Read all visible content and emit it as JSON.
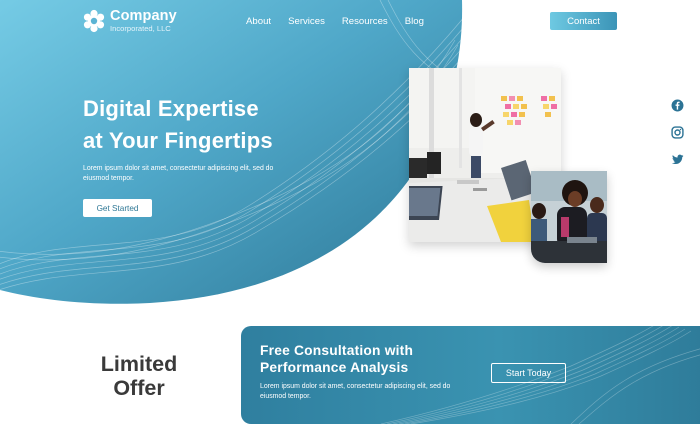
{
  "colors": {
    "accent": "#3b94b7",
    "hero_light": "#6cc4e0",
    "hero_dark": "#2f7898",
    "offer_text": "#3a3a3a"
  },
  "brand": {
    "name": "Company",
    "subtitle": "Incorporated, LLC",
    "logo_icon": "flower-gear-logo"
  },
  "nav": {
    "items": [
      {
        "label": "About"
      },
      {
        "label": "Services"
      },
      {
        "label": "Resources"
      },
      {
        "label": "Blog"
      }
    ],
    "contact_label": "Contact"
  },
  "hero": {
    "title_line1": "Digital Expertise",
    "title_line2": "at Your Fingertips",
    "description": "Lorem ipsum dolor sit amet, consectetur adipiscing elit, sed do eiusmod tempor.",
    "cta_label": "Get Started"
  },
  "social": {
    "icons": [
      "facebook-icon",
      "instagram-icon",
      "twitter-icon"
    ]
  },
  "offer": {
    "heading_line1": "Limited",
    "heading_line2": "Offer",
    "title_line1": "Free Consultation with",
    "title_line2": "Performance Analysis",
    "description": "Lorem ipsum dolor sit amet, consectetur adipiscing elit, sed do eiusmod tempor.",
    "cta_label": "Start Today"
  }
}
